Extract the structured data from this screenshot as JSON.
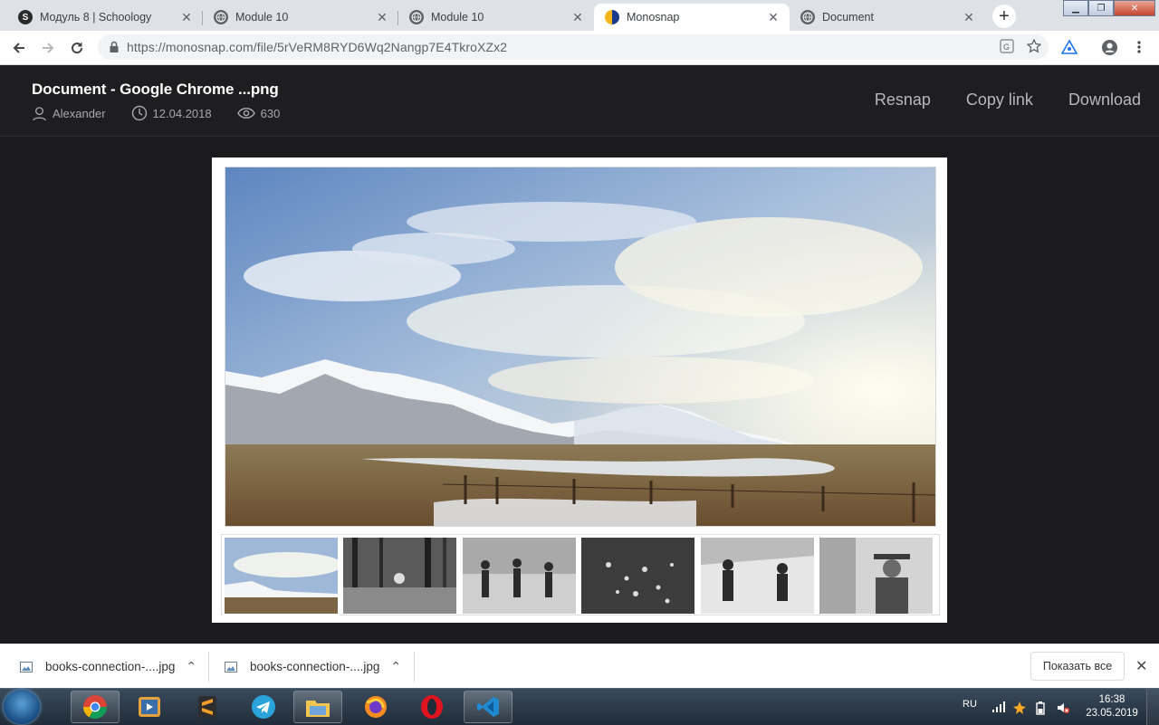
{
  "browser": {
    "tabs": [
      {
        "label": "Модуль 8 | Schoology",
        "favicon": "schoology-icon",
        "active": false
      },
      {
        "label": "Module 10",
        "favicon": "globe-icon",
        "active": false
      },
      {
        "label": "Module 10",
        "favicon": "globe-icon",
        "active": false
      },
      {
        "label": "Monosnap",
        "favicon": "monosnap-icon",
        "active": true
      },
      {
        "label": "Document",
        "favicon": "globe-icon",
        "active": false
      }
    ],
    "new_tab_symbol": "+",
    "url": "https://monosnap.com/file/5rVeRM8RYD6Wq2Nangp7E4TkroXZx2"
  },
  "header": {
    "title": "Document - Google Chrome ...png",
    "author": "Alexander",
    "date": "12.04.2018",
    "views": "630",
    "actions": {
      "resnap": "Resnap",
      "copy_link": "Copy link",
      "download": "Download"
    }
  },
  "viewer": {
    "thumbnails": [
      {
        "subject": "mountain landscape",
        "selected": true
      },
      {
        "subject": "forest river",
        "selected": false
      },
      {
        "subject": "fitness class",
        "selected": false
      },
      {
        "subject": "hearts bokeh",
        "selected": false
      },
      {
        "subject": "snow couple",
        "selected": false
      },
      {
        "subject": "man with hat",
        "selected": false
      }
    ]
  },
  "downloads": {
    "items": [
      {
        "name": "books-connection-....jpg"
      },
      {
        "name": "books-connection-....jpg"
      }
    ],
    "show_all": "Показать все"
  },
  "taskbar": {
    "apps": [
      "chrome-icon",
      "media-player-icon",
      "sublime-text-icon",
      "telegram-icon",
      "file-explorer-icon",
      "firefox-icon",
      "opera-icon",
      "vscode-icon"
    ],
    "language": "RU",
    "time": "16:38",
    "date": "23.05.2019"
  },
  "colors": {
    "page_bg": "#1b1b1d",
    "header_text": "#ffffff",
    "action_text": "#b8b8bc",
    "tab_strip": "#dee1e6"
  }
}
